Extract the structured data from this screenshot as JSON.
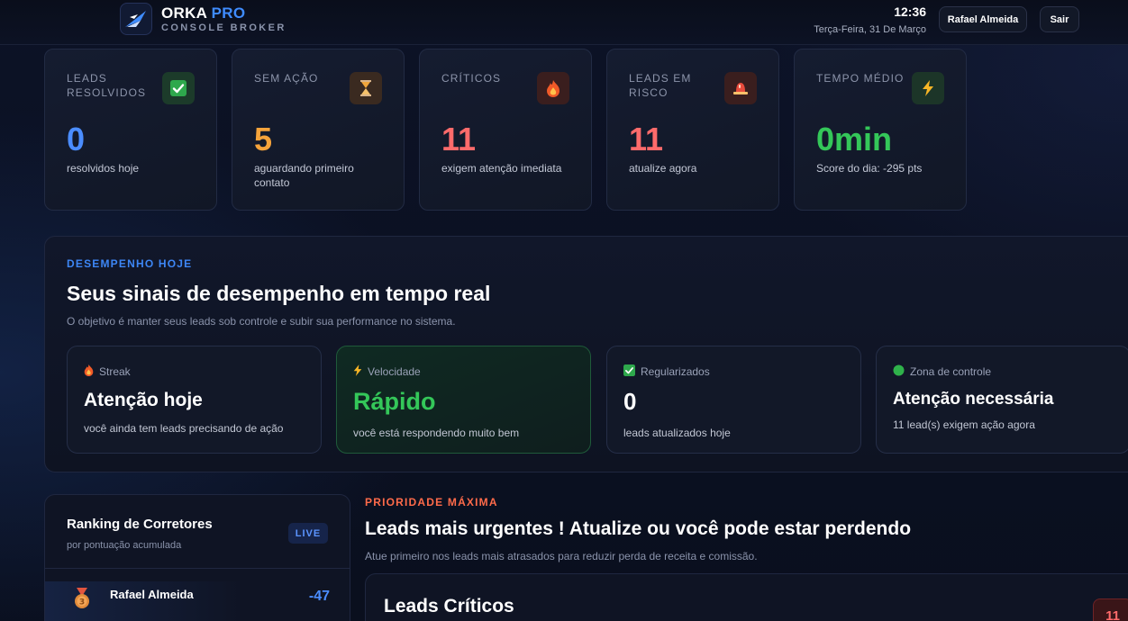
{
  "header": {
    "brand_main": "ORKA",
    "brand_accent": "PRO",
    "brand_sub": "CONSOLE BROKER",
    "time": "12:36",
    "date": "Terça-Feira, 31 De Março",
    "user_button": "Rafael Almeida",
    "logout_button": "Sair"
  },
  "stats": [
    {
      "label": "Leads resolvidos",
      "icon": "check-icon",
      "value": "0",
      "desc": "resolvidos hoje",
      "color": "#4b8dff"
    },
    {
      "label": "Sem ação",
      "icon": "hourglass-icon",
      "value": "5",
      "desc": "aguardando primeiro contato",
      "color": "#f5a33b"
    },
    {
      "label": "Críticos",
      "icon": "fire-icon",
      "value": "11",
      "desc": "exigem atenção imediata",
      "color": "#ff6b6b"
    },
    {
      "label": "Leads em risco",
      "icon": "alarm-icon",
      "value": "11",
      "desc": "atualize agora",
      "color": "#ff6b6b"
    },
    {
      "label": "Tempo médio",
      "icon": "lightning-icon",
      "value": "0min",
      "desc": "Score do dia: -295 pts",
      "color": "#34c759"
    }
  ],
  "performance": {
    "kicker": "DESEMPENHO HOJE",
    "title": "Seus sinais de desempenho em tempo real",
    "subtitle": "O objetivo é manter seus leads sob controle e subir sua performance no sistema.",
    "signals": [
      {
        "label": "Streak",
        "icon": "fire-icon",
        "value": "Atenção hoje",
        "desc": "você ainda tem leads precisando de ação"
      },
      {
        "label": "Velocidade",
        "icon": "lightning-icon",
        "value": "Rápido",
        "desc": "você está respondendo muito bem"
      },
      {
        "label": "Regularizados",
        "icon": "check-icon",
        "value": "0",
        "desc": "leads atualizados hoje"
      },
      {
        "label": "Zona de controle",
        "icon": "green-dot-icon",
        "value": "Atenção necessária",
        "desc": "11 lead(s) exigem ação agora"
      }
    ]
  },
  "ranking": {
    "title": "Ranking de Corretores",
    "subtitle": "por pontuação acumulada",
    "badge": "LIVE",
    "rows": [
      {
        "name": "Rafael Almeida",
        "score": "-47",
        "icon": "bronze-medal-icon"
      }
    ]
  },
  "urgent": {
    "kicker": "PRIORIDADE MÁXIMA",
    "title": "Leads mais urgentes ! Atualize ou você pode estar perdendo",
    "subtitle": "Atue primeiro nos leads mais atrasados para reduzir perda de receita e comissão.",
    "panel_title": "Leads Críticos",
    "panel_count": "11"
  }
}
